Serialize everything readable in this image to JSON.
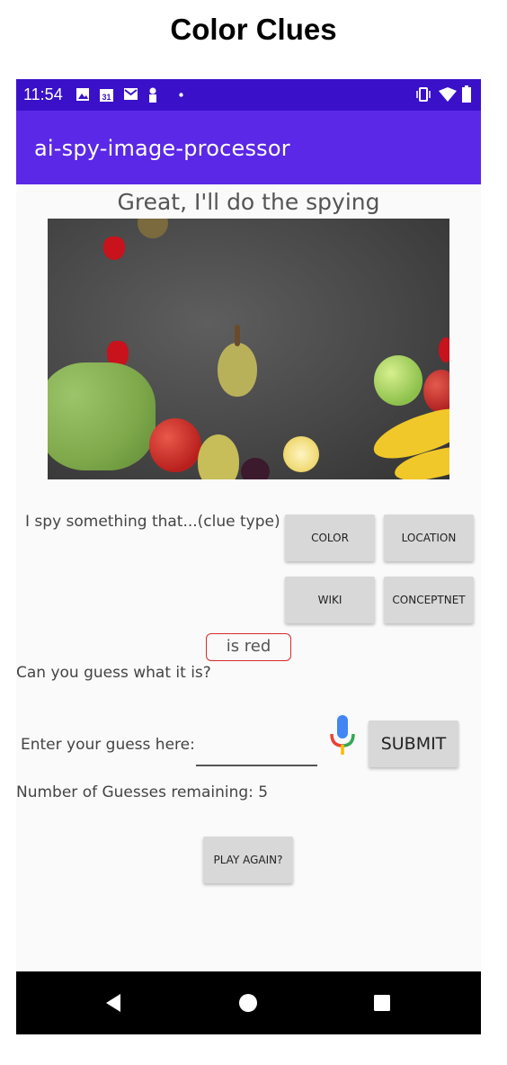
{
  "heading": "Color Clues",
  "status_bar": {
    "time": "11:54",
    "left_icons": [
      "image-icon",
      "calendar-icon",
      "gmail-icon",
      "person-icon",
      "dot-icon"
    ],
    "calendar_day": "31",
    "right_icons": [
      "vibrate-icon",
      "wifi-icon",
      "battery-icon"
    ]
  },
  "app_bar": {
    "title": "ai-spy-image-processor"
  },
  "prompt": "Great, I'll do the spying",
  "clue_section": {
    "label": "I spy something that...(clue type)",
    "buttons": [
      "COLOR",
      "LOCATION",
      "WIKI",
      "CONCEPTNET"
    ]
  },
  "clue_result": "is red",
  "question": "Can you guess what it is?",
  "guess": {
    "label": "Enter your guess here:",
    "value": "",
    "submit_label": "SUBMIT"
  },
  "guesses_remaining": "Number of Guesses remaining: 5",
  "play_again_label": "PLAY AGAIN?",
  "colors": {
    "status_bar": "#3a11c9",
    "app_bar": "#5a28e6",
    "clue_border": "#d92b2b"
  }
}
